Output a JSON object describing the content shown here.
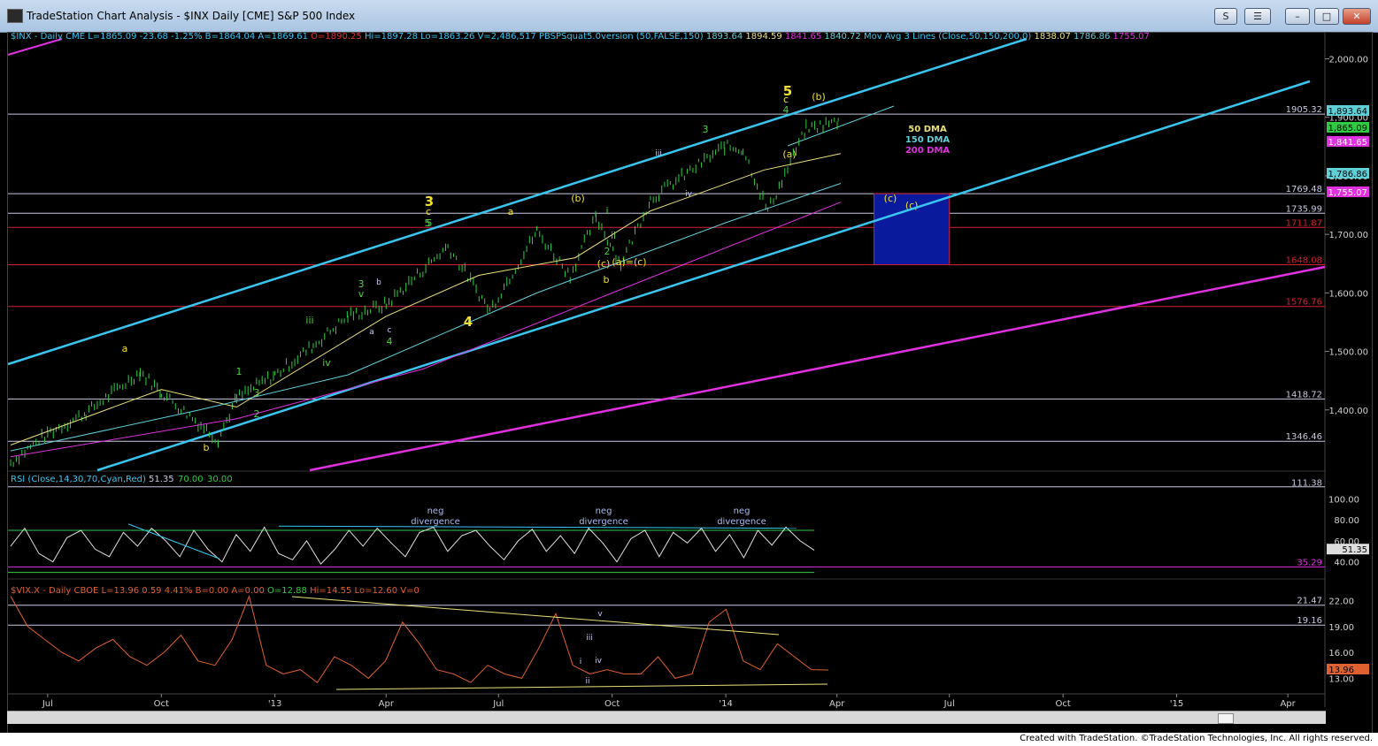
{
  "window": {
    "title": "TradeStation Chart Analysis - $INX Daily [CME] S&P 500 Index",
    "buttons": [
      "S",
      "☰",
      "–",
      "□",
      "✕"
    ]
  },
  "footer": "Created with TradeStation. ©TradeStation Technologies, Inc. All rights reserved.",
  "colors": {
    "background": "#000000",
    "price_bars": "#2ecc40",
    "channel": "#38c6f0",
    "ma50": "#e8e07a",
    "ma150": "#5fd0d8",
    "ma200": "#e030e0",
    "hline_white": "#c8c8e0",
    "hline_red": "#d02030",
    "target_box": "#0a1a9c",
    "wave_yellow": "#f0e030",
    "wave_green": "#50d040",
    "rsi": "#e0e0e0",
    "vix": "#e06030"
  },
  "panels": {
    "price": {
      "header": [
        {
          "t": "$INX - Daily  CME  L=1865.09  -23.68  -1.25%  B=1864.04  A=1869.61",
          "c": "#38c6f0"
        },
        {
          "t": "O=1890.25",
          "c": "#e03030"
        },
        {
          "t": "Hi=1897.28  Lo=1863.26  V=2,486,517  PBSPSquat5.0version (50,FALSE,150)",
          "c": "#38c6f0"
        },
        {
          "t": "1893.64",
          "c": "#5fd0d8"
        },
        {
          "t": "1894.59",
          "c": "#e8e07a"
        },
        {
          "t": "1841.65",
          "c": "#e030e0"
        },
        {
          "t": "1840.72",
          "c": "#5fd0d8"
        },
        {
          "t": "Mov Avg 3 Lines (Close,50,150,200,0)",
          "c": "#38c6f0"
        },
        {
          "t": "1838.07",
          "c": "#e8e07a"
        },
        {
          "t": "1786.86",
          "c": "#5fd0d8"
        },
        {
          "t": "1755.07",
          "c": "#e030e0"
        }
      ],
      "axis_ticks": [
        "2,000.00",
        "1,900.00",
        "1,800.00",
        "1,700.00",
        "1,600.00",
        "1,500.00",
        "1,400.00"
      ],
      "level_labels": [
        {
          "t": "1905.32",
          "c": "#c8c8e0"
        },
        {
          "t": "1769.48",
          "c": "#c8c8e0"
        },
        {
          "t": "1735.99",
          "c": "#c8c8e0"
        },
        {
          "t": "1711.87",
          "c": "#d02030"
        },
        {
          "t": "1648.08",
          "c": "#d02030"
        },
        {
          "t": "1576.76",
          "c": "#d02030"
        },
        {
          "t": "1418.72",
          "c": "#c8c8e0"
        },
        {
          "t": "1346.46",
          "c": "#c8c8e0"
        }
      ],
      "price_tags": [
        {
          "t": "1,893.64",
          "bg": "#5fd0d8",
          "fg": "#000"
        },
        {
          "t": "1,865.09",
          "bg": "#2ecc40",
          "fg": "#000"
        },
        {
          "t": "1,841.65",
          "bg": "#e030e0",
          "fg": "#fff"
        },
        {
          "t": "1,786.86",
          "bg": "#5fd0d8",
          "fg": "#000"
        },
        {
          "t": "1,755.07",
          "bg": "#e030e0",
          "fg": "#fff"
        }
      ],
      "legend": [
        {
          "t": "50 DMA",
          "c": "#e8e07a"
        },
        {
          "t": "150 DMA",
          "c": "#5fd0d8"
        },
        {
          "t": "200 DMA",
          "c": "#e030e0"
        }
      ],
      "wave_labels": {
        "yellow_big": [
          "3",
          "4",
          "5"
        ],
        "yellow": [
          "a",
          "b",
          "c",
          "a",
          "b",
          "(b)",
          "(a)",
          "(c)",
          "(a)=(c)",
          "c",
          "(b)",
          "(c)"
        ],
        "green": [
          "1",
          "2",
          "3",
          "4",
          "5",
          "3",
          "4",
          "5",
          "v",
          "iii",
          "iv",
          "3",
          "i",
          "ii",
          "2"
        ],
        "blue": [
          "a",
          "b",
          "c",
          "iii",
          "iv"
        ]
      }
    },
    "rsi": {
      "header": "RSI (Close,14,30,70,Cyan,Red)",
      "values": [
        {
          "t": "51.35",
          "c": "#c8c8e0"
        },
        {
          "t": "70.00",
          "c": "#2ecc40"
        },
        {
          "t": "30.00",
          "c": "#2ecc40"
        }
      ],
      "axis_ticks": [
        "100.00",
        "80.00",
        "60.00",
        "40.00"
      ],
      "top_label": "111.38",
      "current": "51.35",
      "level": "35.29",
      "annotations": [
        "neg divergence",
        "neg divergence",
        "neg divergence"
      ]
    },
    "vix": {
      "header": [
        {
          "t": "$VIX.X - Daily  CBOE  L=13.96  0.59  4.41%  B=0.00  A=0.00",
          "c": "#e06030"
        },
        {
          "t": "O=12.88",
          "c": "#2ecc40"
        },
        {
          "t": "Hi=14.55  Lo=12.60  V=0",
          "c": "#e06030"
        }
      ],
      "axis_ticks": [
        "22.00",
        "19.00",
        "16.00",
        "13.00"
      ],
      "levels": [
        "21.47",
        "19.16"
      ],
      "current": "13.96",
      "wave_labels": [
        "v",
        "iii",
        "iv",
        "i",
        "ii"
      ]
    }
  },
  "x_axis": [
    "Jul",
    "Oct",
    "'13",
    "Apr",
    "Jul",
    "Oct",
    "'14",
    "Apr",
    "Jul",
    "Oct",
    "'15",
    "Apr"
  ],
  "chart_data": [
    {
      "type": "line",
      "title": "$INX Daily S&P 500 Index",
      "ylim": [
        1300,
        2040
      ],
      "x_range": [
        "2012-06",
        "2015-05"
      ],
      "series": [
        {
          "name": "$INX",
          "style": "ohlc-bars",
          "x": [
            "2012-06-01",
            "2012-07-01",
            "2012-08-01",
            "2012-09-14",
            "2012-10-01",
            "2012-11-16",
            "2012-12-01",
            "2013-01-01",
            "2013-02-01",
            "2013-03-01",
            "2013-04-01",
            "2013-05-21",
            "2013-06-24",
            "2013-08-01",
            "2013-08-28",
            "2013-09-18",
            "2013-10-08",
            "2013-11-01",
            "2013-12-31",
            "2014-01-15",
            "2014-02-04",
            "2014-03-07",
            "2014-04-02",
            "2014-04-04"
          ],
          "values": [
            1310,
            1360,
            1395,
            1465,
            1430,
            1350,
            1420,
            1460,
            1510,
            1560,
            1580,
            1680,
            1570,
            1705,
            1630,
            1730,
            1650,
            1760,
            1850,
            1845,
            1740,
            1880,
            1893,
            1865
          ]
        },
        {
          "name": "50 DMA",
          "x": [
            "2012-06-01",
            "2012-10-01",
            "2012-12-01",
            "2013-04-01",
            "2013-06-15",
            "2013-09-01",
            "2013-11-01",
            "2014-02-01",
            "2014-04-04"
          ],
          "values": [
            1340,
            1435,
            1405,
            1560,
            1630,
            1660,
            1740,
            1810,
            1838
          ]
        },
        {
          "name": "150 DMA",
          "x": [
            "2012-06-01",
            "2012-11-01",
            "2013-03-01",
            "2013-08-01",
            "2014-01-01",
            "2014-04-04"
          ],
          "values": [
            1330,
            1400,
            1460,
            1600,
            1720,
            1787
          ]
        },
        {
          "name": "200 DMA",
          "x": [
            "2012-06-01",
            "2012-12-01",
            "2013-05-01",
            "2013-10-01",
            "2014-04-04"
          ],
          "values": [
            1320,
            1385,
            1470,
            1600,
            1755
          ]
        }
      ],
      "horizontal_levels": [
        1905.32,
        1769.48,
        1735.99,
        1711.87,
        1648.08,
        1576.76,
        1418.72,
        1346.46
      ],
      "target_box": {
        "x": [
          "2014-05",
          "2014-07"
        ],
        "y": [
          1648.08,
          1769.48
        ],
        "label": "(c)"
      }
    },
    {
      "type": "line",
      "title": "RSI (Close,14,30,70,Cyan,Red)",
      "ylim": [
        28,
        112
      ],
      "series": [
        {
          "name": "RSI",
          "values": [
            55,
            72,
            48,
            40,
            63,
            70,
            52,
            45,
            68,
            55,
            72,
            60,
            45,
            70,
            52,
            40,
            66,
            50,
            73,
            48,
            42,
            60,
            38,
            52,
            70,
            55,
            72,
            58,
            45,
            68,
            73,
            50,
            65,
            70,
            55,
            42,
            60,
            71,
            50,
            65,
            48,
            72,
            58,
            40,
            62,
            70,
            45,
            68,
            58,
            72,
            50,
            66,
            44,
            70,
            56,
            73,
            60,
            51
          ]
        }
      ],
      "levels": [
        70,
        30,
        35.29
      ]
    },
    {
      "type": "line",
      "title": "$VIX.X Daily",
      "ylim": [
        11.5,
        24
      ],
      "series": [
        {
          "name": "VIX",
          "values": [
            22.5,
            19,
            17.5,
            16,
            15,
            16.5,
            17.5,
            15.5,
            14.5,
            16,
            18,
            15,
            14.5,
            17.5,
            22.5,
            14.5,
            13.5,
            14,
            12.5,
            15.5,
            14.5,
            13,
            15,
            19.5,
            17,
            14,
            13.5,
            12.5,
            14.5,
            13.5,
            13,
            16.5,
            20.5,
            14.5,
            13.5,
            14,
            13.5,
            13.5,
            15.5,
            13,
            13.5,
            19.5,
            21,
            15,
            14,
            17,
            15.5,
            14,
            13.96
          ]
        }
      ],
      "levels": [
        21.47,
        19.16
      ]
    }
  ]
}
